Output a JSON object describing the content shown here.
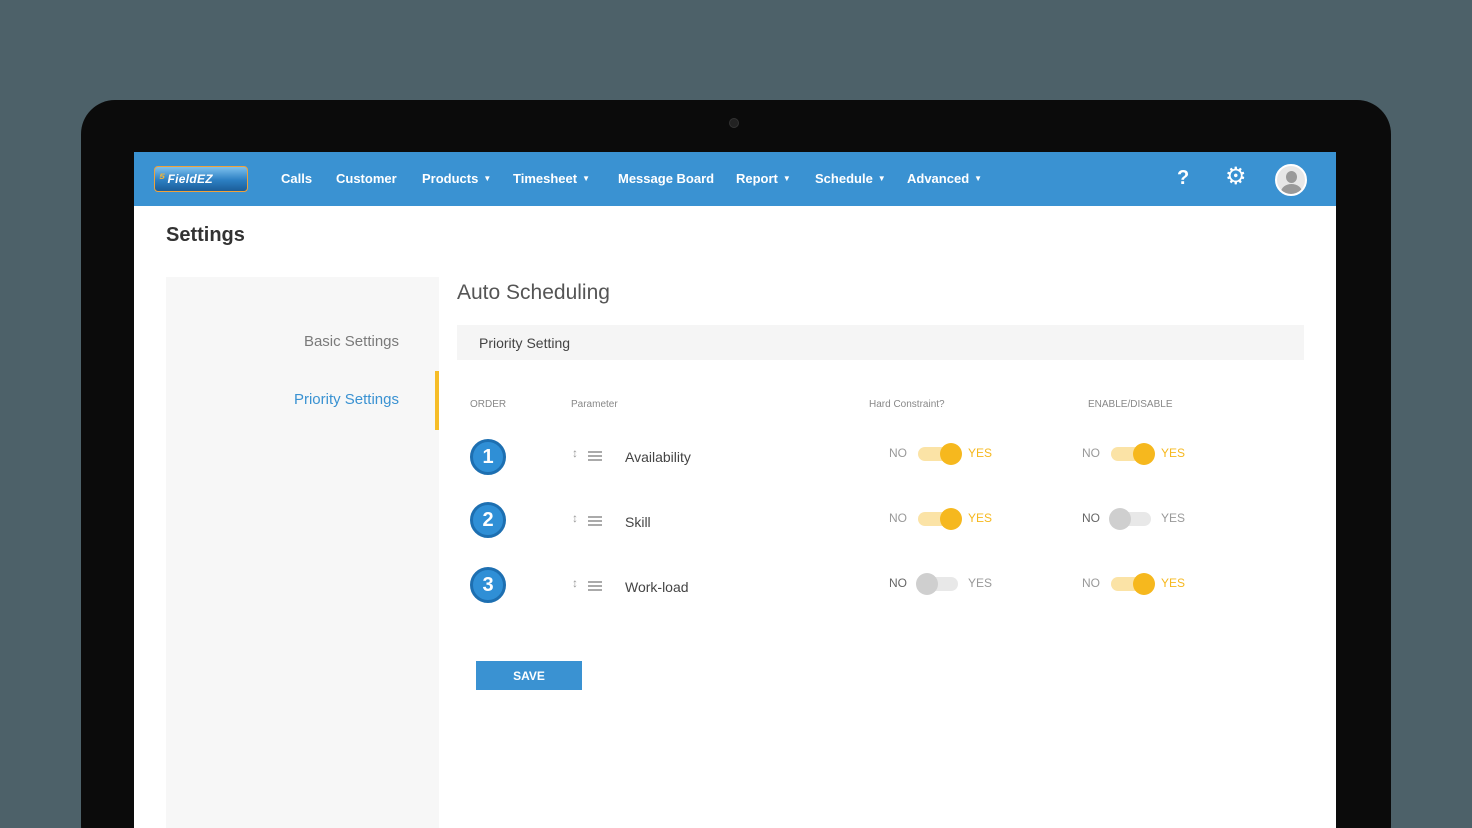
{
  "app": {
    "logo_text": "FieldEZ",
    "nav": [
      {
        "label": "Calls",
        "dropdown": false
      },
      {
        "label": "Customer",
        "dropdown": false
      },
      {
        "label": "Products",
        "dropdown": true
      },
      {
        "label": "Timesheet",
        "dropdown": true
      },
      {
        "label": "Message Board",
        "dropdown": false
      },
      {
        "label": "Report",
        "dropdown": true
      },
      {
        "label": "Schedule",
        "dropdown": true
      },
      {
        "label": "Advanced",
        "dropdown": true
      }
    ],
    "help_icon": "?",
    "settings_icon": "gear-icon",
    "avatar_icon": "user-avatar-icon",
    "colors": {
      "primary": "#3a92d2",
      "accent": "#f6b81e",
      "background": "#4d6169"
    }
  },
  "page": {
    "title": "Settings"
  },
  "sidebar": {
    "items": [
      {
        "label": "Basic Settings",
        "active": false
      },
      {
        "label": "Priority Settings",
        "active": true
      }
    ]
  },
  "main": {
    "title": "Auto Scheduling",
    "section_label": "Priority Setting",
    "columns": {
      "order": "ORDER",
      "parameter": "Parameter",
      "hard_constraint": "Hard Constraint?",
      "enable": "ENABLE/DISABLE"
    },
    "toggle_labels": {
      "no": "NO",
      "yes": "YES"
    },
    "rows": [
      {
        "order": "1",
        "parameter": "Availability",
        "hard_constraint": true,
        "enabled": true
      },
      {
        "order": "2",
        "parameter": "Skill",
        "hard_constraint": true,
        "enabled": false
      },
      {
        "order": "3",
        "parameter": "Work-load",
        "hard_constraint": false,
        "enabled": true
      }
    ],
    "save_label": "SAVE"
  }
}
